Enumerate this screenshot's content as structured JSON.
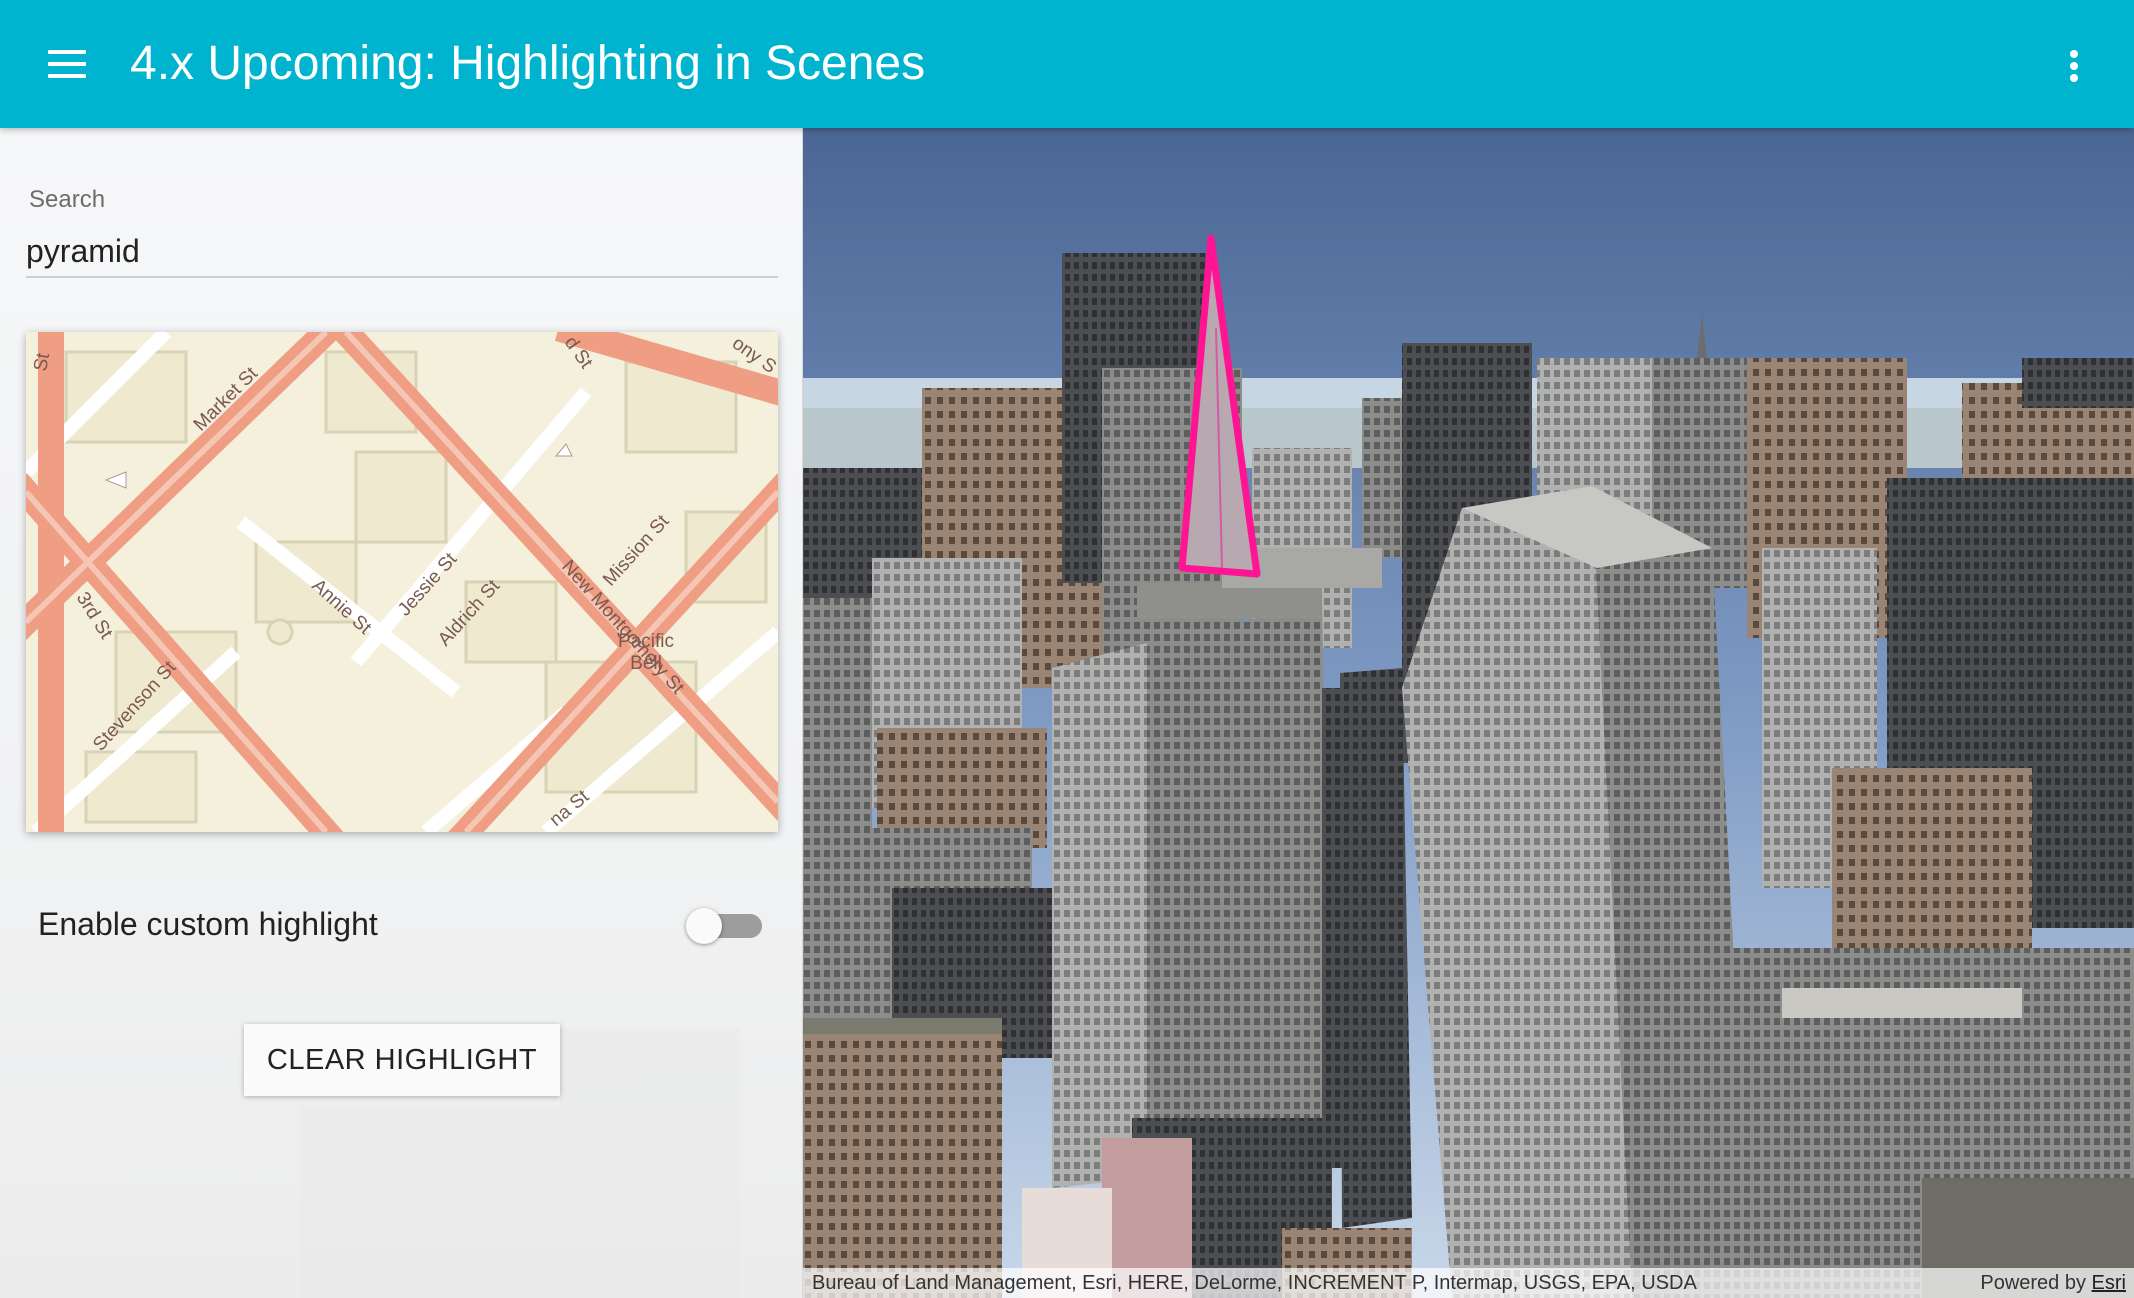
{
  "header": {
    "title": "4.x Upcoming: Highlighting in Scenes",
    "menu_icon": "hamburger-menu-icon",
    "more_icon": "more-vertical-icon",
    "background_color": "#00B4D0"
  },
  "sidebar": {
    "search": {
      "label": "Search",
      "value": "pyramid"
    },
    "minimap": {
      "street_labels": [
        "Market St",
        "3rd St",
        "Stevenson St",
        "Annie St",
        "Jessie St",
        "Aldrich St",
        "New Montgomery St",
        "Mission St",
        "Pacific",
        "Bell",
        "St",
        "d St",
        "ony S",
        "na St"
      ]
    },
    "toggle": {
      "label": "Enable custom highlight",
      "enabled": false
    },
    "clear_button": {
      "label": "CLEAR HIGHLIGHT"
    }
  },
  "scene": {
    "highlight_color": "#FF1493",
    "attribution": {
      "sources": "Bureau of Land Management, Esri, HERE, DeLorme, INCREMENT P, Intermap, USGS, EPA, USDA",
      "powered_by": "Powered by",
      "powered_by_link": "Esri"
    }
  }
}
